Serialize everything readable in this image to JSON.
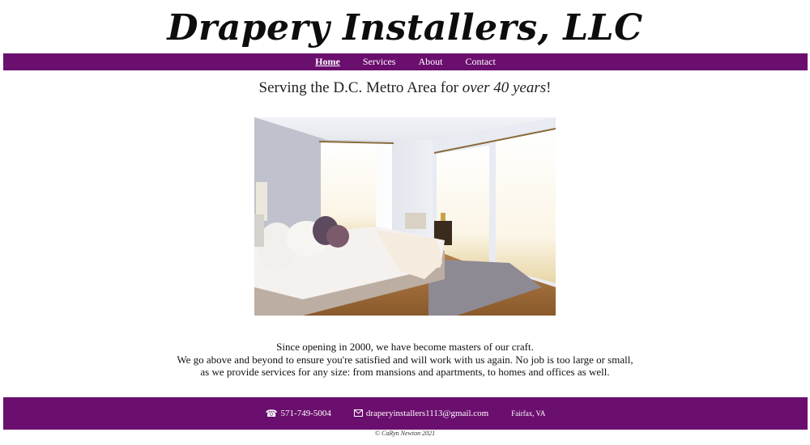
{
  "header": {
    "site_title": "Drapery Installers, LLC"
  },
  "nav": {
    "items": [
      {
        "label": "Home",
        "active": true
      },
      {
        "label": "Services",
        "active": false
      },
      {
        "label": "About",
        "active": false
      },
      {
        "label": "Contact",
        "active": false
      }
    ]
  },
  "main": {
    "tagline_prefix": "Serving the D.C. Metro Area for ",
    "tagline_emphasis": "over 40 years",
    "tagline_suffix": "!",
    "hero_image": "bedroom-with-sheer-drapes",
    "about_lines": [
      "Since opening in 2000, we have become masters of our craft.",
      "We go above and beyond to ensure you're satisfied and will work with us again. No job is too large or small,",
      "as we provide services for any size: from mansions and apartments, to homes and offices as well."
    ]
  },
  "footer": {
    "phone_icon": "phone-icon",
    "phone": "571-749-5004",
    "email_icon": "envelope-icon",
    "email": "draperyinstallers1113@gmail.com",
    "location": "Fairfax, VA",
    "copyright": "© CaRyn Newton 2021"
  },
  "colors": {
    "brand_purple": "#6b0f6e",
    "text": "#111111",
    "background": "#ffffff"
  }
}
